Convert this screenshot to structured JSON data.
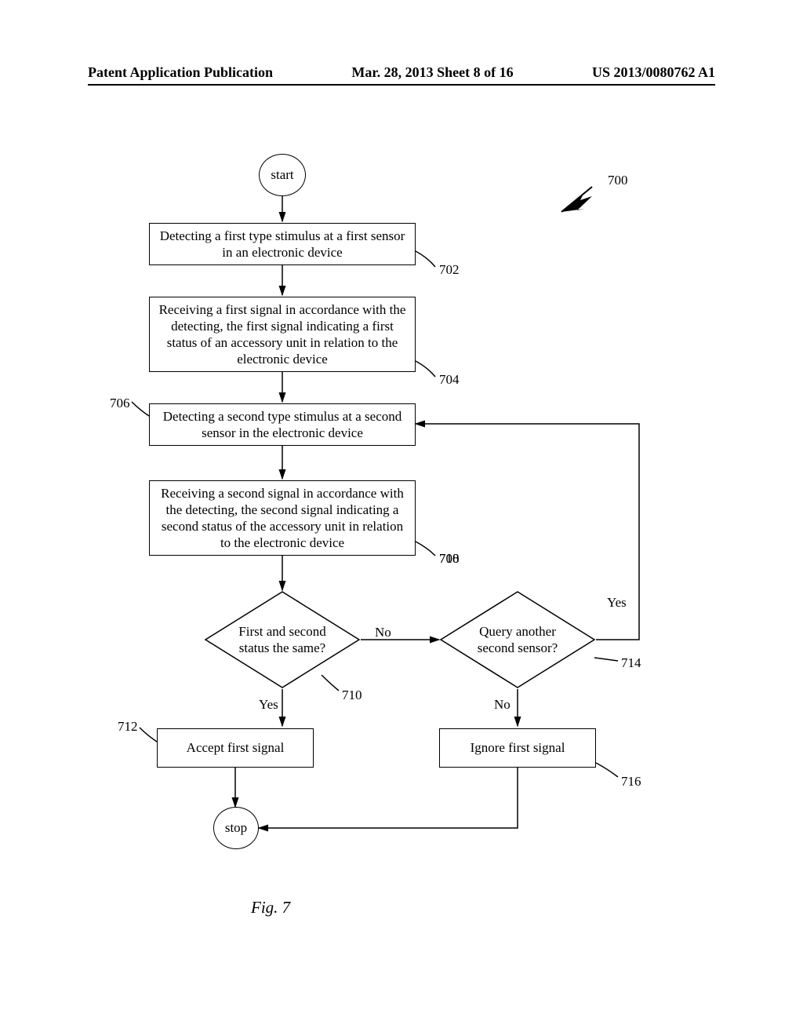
{
  "header": {
    "left": "Patent Application Publication",
    "center": "Mar. 28, 2013  Sheet 8 of 16",
    "right": "US 2013/0080762 A1"
  },
  "flow": {
    "start": "start",
    "step702": "Detecting a first type stimulus at a first sensor in an electronic device",
    "step704": "Receiving a first signal in accordance with the detecting, the first signal indicating a first status of an accessory unit in relation to the electronic device",
    "step706": "Detecting a second type stimulus at a second sensor in the electronic device",
    "step708": "Receiving a second signal in accordance with the detecting, the second signal indicating a second status of the accessory unit in relation to the electronic device",
    "dec710": "First and second status the same?",
    "dec714": "Query another second sensor?",
    "step712": "Accept first signal",
    "step716": "Ignore first signal",
    "stop": "stop",
    "ref700": "700",
    "ref702": "702",
    "ref704": "704",
    "ref706": "706",
    "ref708": "708",
    "ref710": "710",
    "ref712": "712",
    "ref714": "714",
    "ref716": "716",
    "yes": "Yes",
    "no": "No"
  },
  "caption": "Fig. 7"
}
